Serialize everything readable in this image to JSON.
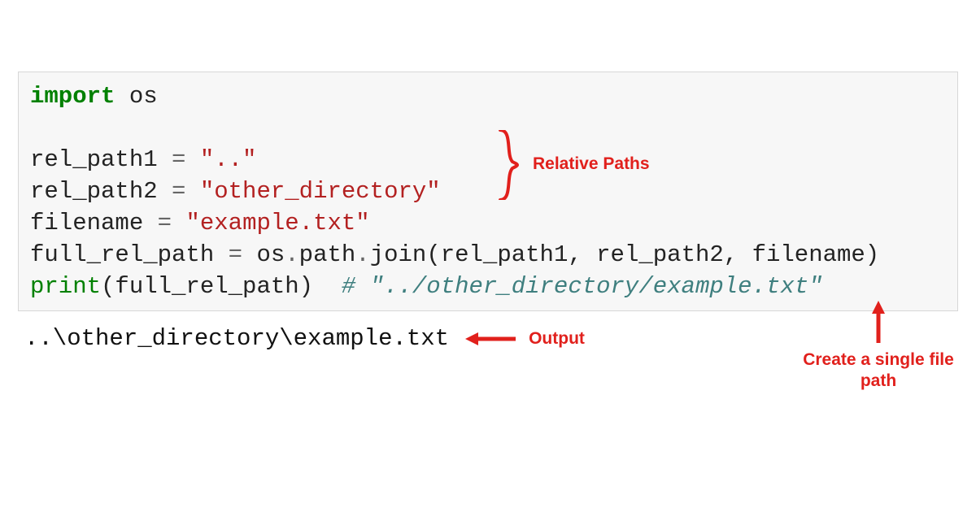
{
  "code": {
    "lines": [
      {
        "tokens": [
          {
            "cls": "kw",
            "t": "import"
          },
          {
            "cls": "",
            "t": " os"
          }
        ]
      },
      {
        "tokens": [
          {
            "cls": "",
            "t": ""
          }
        ]
      },
      {
        "tokens": [
          {
            "cls": "",
            "t": "rel_path1 "
          },
          {
            "cls": "op",
            "t": "="
          },
          {
            "cls": "",
            "t": " "
          },
          {
            "cls": "str",
            "t": "\"..\""
          }
        ]
      },
      {
        "tokens": [
          {
            "cls": "",
            "t": "rel_path2 "
          },
          {
            "cls": "op",
            "t": "="
          },
          {
            "cls": "",
            "t": " "
          },
          {
            "cls": "str",
            "t": "\"other_directory\""
          }
        ]
      },
      {
        "tokens": [
          {
            "cls": "",
            "t": "filename "
          },
          {
            "cls": "op",
            "t": "="
          },
          {
            "cls": "",
            "t": " "
          },
          {
            "cls": "str",
            "t": "\"example.txt\""
          }
        ]
      },
      {
        "tokens": [
          {
            "cls": "",
            "t": "full_rel_path "
          },
          {
            "cls": "op",
            "t": "="
          },
          {
            "cls": "",
            "t": " os"
          },
          {
            "cls": "op",
            "t": "."
          },
          {
            "cls": "",
            "t": "path"
          },
          {
            "cls": "op",
            "t": "."
          },
          {
            "cls": "",
            "t": "join(rel_path1, rel_path2, filename)"
          }
        ]
      },
      {
        "tokens": [
          {
            "cls": "builtin",
            "t": "print"
          },
          {
            "cls": "",
            "t": "(full_rel_path)  "
          },
          {
            "cls": "comment",
            "t": "# \"../other_directory/example.txt\""
          }
        ]
      }
    ]
  },
  "annotations": {
    "relative_paths": "Relative Paths",
    "output_label": "Output",
    "single_file_label": "Create a single file\npath"
  },
  "output": "..\\other_directory\\example.txt",
  "colors": {
    "annotation": "#e1201c",
    "keyword": "#008000",
    "string": "#b32121",
    "comment": "#3f7f7f",
    "operator": "#666666",
    "code_bg": "#f7f7f7"
  }
}
